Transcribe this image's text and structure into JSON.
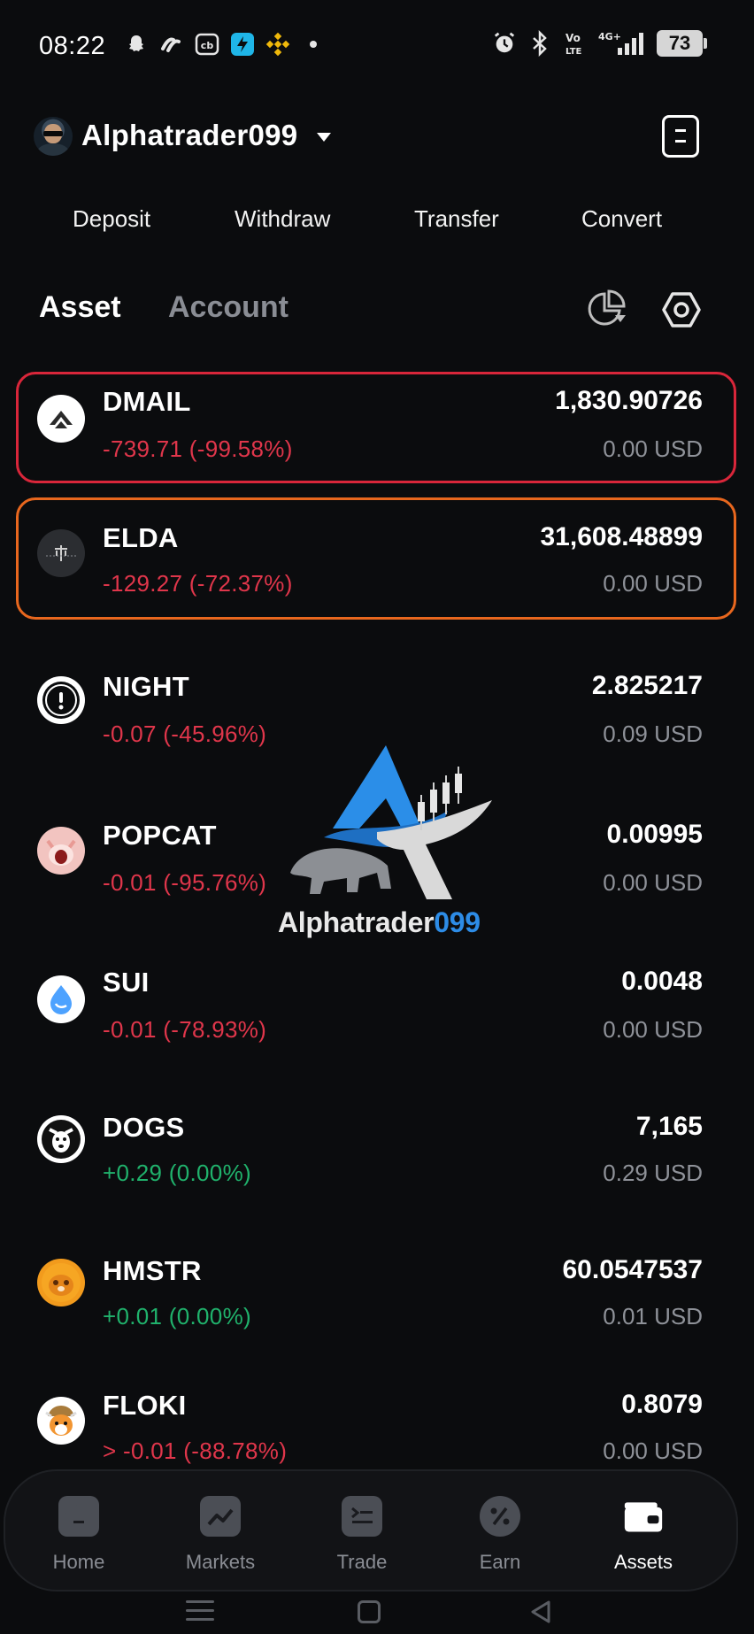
{
  "status_bar": {
    "time": "08:22",
    "battery": "73",
    "network": "4G+"
  },
  "header": {
    "username": "Alphatrader099"
  },
  "actions": [
    "Deposit",
    "Withdraw",
    "Transfer",
    "Convert"
  ],
  "tabs": {
    "asset": "Asset",
    "account": "Account"
  },
  "assets": [
    {
      "symbol": "DMAIL",
      "pnl": "-739.71 (-99.58%)",
      "amount": "1,830.90726",
      "usd": "0.00 USD",
      "trend": "neg",
      "highlight": "#d9263a",
      "icon": "dmail-icon"
    },
    {
      "symbol": "ELDA",
      "pnl": "-129.27 (-72.37%)",
      "amount": "31,608.48899",
      "usd": "0.00 USD",
      "trend": "neg",
      "highlight": "#e8671e",
      "icon": "elda-icon"
    },
    {
      "symbol": "NIGHT",
      "pnl": "-0.07 (-45.96%)",
      "amount": "2.825217",
      "usd": "0.09 USD",
      "trend": "neg",
      "highlight": "",
      "icon": "night-icon"
    },
    {
      "symbol": "POPCAT",
      "pnl": "-0.01 (-95.76%)",
      "amount": "0.00995",
      "usd": "0.00 USD",
      "trend": "neg",
      "highlight": "",
      "icon": "popcat-icon"
    },
    {
      "symbol": "SUI",
      "pnl": "-0.01 (-78.93%)",
      "amount": "0.0048",
      "usd": "0.00 USD",
      "trend": "neg",
      "highlight": "",
      "icon": "sui-icon"
    },
    {
      "symbol": "DOGS",
      "pnl": "+0.29 (0.00%)",
      "amount": "7,165",
      "usd": "0.29 USD",
      "trend": "pos",
      "highlight": "",
      "icon": "dogs-icon"
    },
    {
      "symbol": "HMSTR",
      "pnl": "+0.01 (0.00%)",
      "amount": "60.0547537",
      "usd": "0.01 USD",
      "trend": "pos",
      "highlight": "",
      "icon": "hmstr-icon"
    },
    {
      "symbol": "FLOKI",
      "pnl": "> -0.01 (-88.78%)",
      "amount": "0.8079",
      "usd": "0.00 USD",
      "trend": "neg",
      "highlight": "",
      "icon": "floki-icon"
    }
  ],
  "watermark": {
    "text_main": "Alphatrader",
    "text_accent": "099"
  },
  "bottom_nav": [
    {
      "label": "Home",
      "icon": "home-icon",
      "active": false
    },
    {
      "label": "Markets",
      "icon": "markets-icon",
      "active": false
    },
    {
      "label": "Trade",
      "icon": "trade-icon",
      "active": false
    },
    {
      "label": "Earn",
      "icon": "earn-icon",
      "active": false
    },
    {
      "label": "Assets",
      "icon": "wallet-icon",
      "active": true
    }
  ],
  "colors": {
    "negative": "#e0364b",
    "positive": "#20b26c",
    "background": "#0b0c0e",
    "accent": "#2d8ce6"
  }
}
